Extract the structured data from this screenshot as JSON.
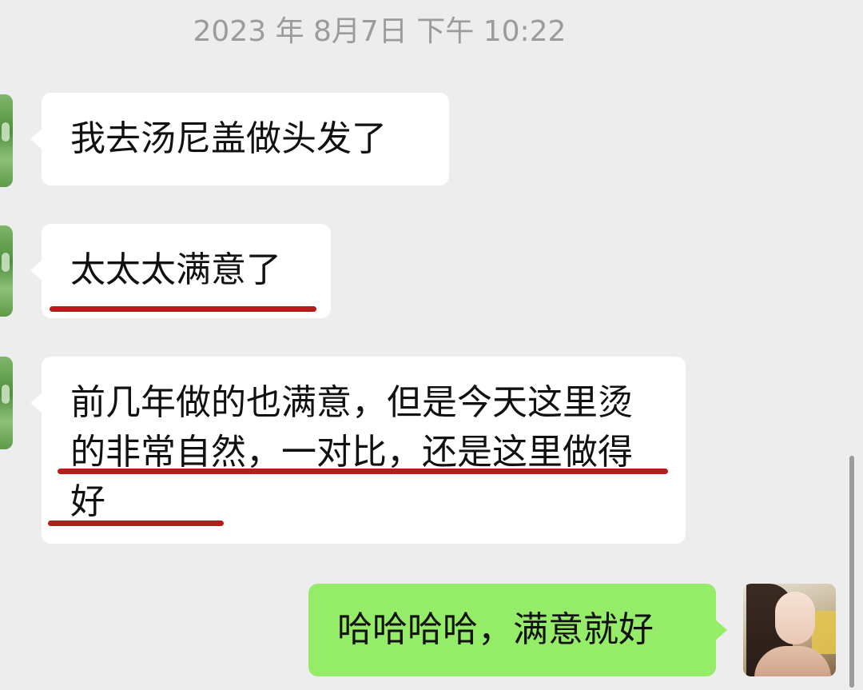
{
  "chat": {
    "timestamp": "2023 年 8月7日 下午 10:22",
    "messages": [
      {
        "sender": "other",
        "text": "我去汤尼盖做头发了"
      },
      {
        "sender": "other",
        "text": "太太太满意了"
      },
      {
        "sender": "other",
        "text": "前几年做的也满意，但是今天这里烫的非常自然，一对比，还是这里做得好"
      },
      {
        "sender": "self",
        "text": "哈哈哈哈，满意就好"
      }
    ]
  },
  "colors": {
    "background": "#ededed",
    "incoming_bubble": "#ffffff",
    "outgoing_bubble": "#95ec69",
    "timestamp_text": "#9b9b9b",
    "annotation_underline": "#b51c1c"
  }
}
